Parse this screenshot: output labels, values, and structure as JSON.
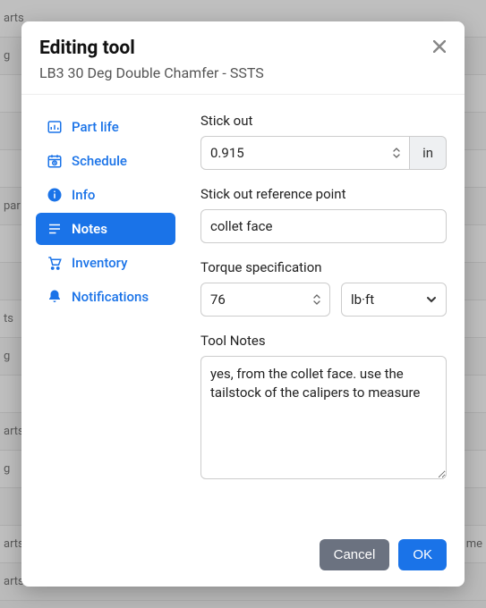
{
  "modal": {
    "title": "Editing tool",
    "subtitle": "LB3 30 Deg Double Chamfer - SSTS"
  },
  "sidebar": {
    "items": [
      {
        "label": "Part life",
        "icon": "part-life-icon",
        "active": false
      },
      {
        "label": "Schedule",
        "icon": "schedule-icon",
        "active": false
      },
      {
        "label": "Info",
        "icon": "info-icon",
        "active": false
      },
      {
        "label": "Notes",
        "icon": "notes-icon",
        "active": true
      },
      {
        "label": "Inventory",
        "icon": "inventory-icon",
        "active": false
      },
      {
        "label": "Notifications",
        "icon": "notifications-icon",
        "active": false
      }
    ]
  },
  "form": {
    "stick_out_label": "Stick out",
    "stick_out_value": "0.915",
    "stick_out_unit": "in",
    "ref_point_label": "Stick out reference point",
    "ref_point_value": "collet face",
    "torque_label": "Torque specification",
    "torque_value": "76",
    "torque_unit": "lb·ft",
    "notes_label": "Tool Notes",
    "notes_value": "yes, from the collet face. use the tailstock of the calipers to measure"
  },
  "footer": {
    "cancel": "Cancel",
    "ok": "OK"
  },
  "bg_fragments": {
    "a": "arts",
    "b": "g",
    "c": "par",
    "d": "ts",
    "e": "me"
  }
}
